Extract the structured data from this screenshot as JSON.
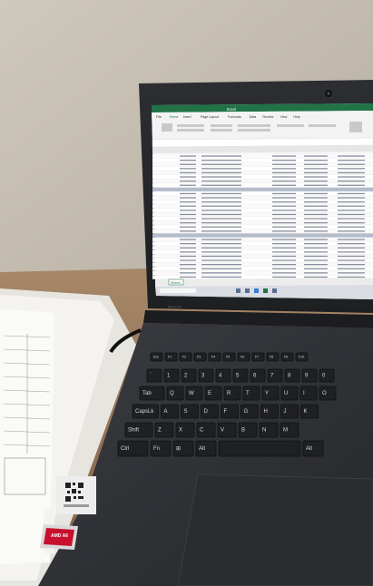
{
  "scene": {
    "description_type": "photo",
    "laptop_brand": "lenovo",
    "sticker": "AMD A6",
    "colors": {
      "wall": "#c4bdb0",
      "desk": "#9b7d60",
      "laptop_body": "#2f3136",
      "keyboard_keys": "#1f2124",
      "excel_green": "#217346",
      "paper": "#f2f2ef"
    }
  },
  "screen": {
    "app_title": "Excel",
    "ribbon_tabs": [
      "File",
      "Home",
      "Insert",
      "Page Layout",
      "Formulas",
      "Data",
      "Review",
      "View",
      "Help"
    ],
    "sheet_tab": "Sheet1"
  },
  "keyboard": {
    "rows": [
      [
        "Esc",
        "F1",
        "F2",
        "F3",
        "F4",
        "F5",
        "F6",
        "F7",
        "F8",
        "F9",
        "F10"
      ],
      [
        "`",
        "1",
        "2",
        "3",
        "4",
        "5",
        "6",
        "7",
        "8",
        "9",
        "0"
      ],
      [
        "Tab",
        "Q",
        "W",
        "E",
        "R",
        "T",
        "Y",
        "U",
        "I",
        "O"
      ],
      [
        "CapsLk",
        "A",
        "S",
        "D",
        "F",
        "G",
        "H",
        "J",
        "K"
      ],
      [
        "Shift",
        "Z",
        "X",
        "C",
        "V",
        "B",
        "N",
        "M"
      ],
      [
        "Ctrl",
        "Fn",
        "⊞",
        "Alt",
        "",
        "Alt"
      ]
    ]
  }
}
